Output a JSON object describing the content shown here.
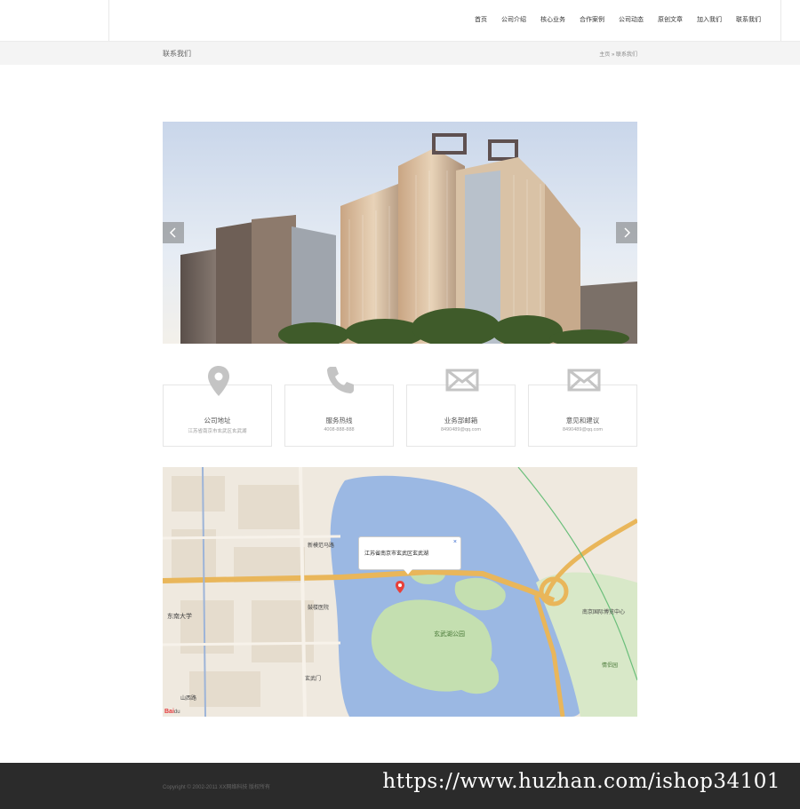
{
  "nav": {
    "items": [
      "首页",
      "公司介绍",
      "核心业务",
      "合作案例",
      "公司动态",
      "原创文章",
      "加入我们",
      "联系我们"
    ]
  },
  "subbar": {
    "title": "联系我们",
    "breadcrumb_home": "主页",
    "breadcrumb_sep": "»",
    "breadcrumb_current": "联系我们"
  },
  "slider": {
    "prev_icon": "chevron-left-icon",
    "next_icon": "chevron-right-icon"
  },
  "contacts": [
    {
      "icon": "location-pin-icon",
      "title": "公司地址",
      "sub": "江苏省南京市玄武区玄武湖"
    },
    {
      "icon": "phone-icon",
      "title": "服务热线",
      "sub": "4008-888-888"
    },
    {
      "icon": "envelope-icon",
      "title": "业务部邮箱",
      "sub": "8490489@qq.com"
    },
    {
      "icon": "envelope-icon",
      "title": "意见和建议",
      "sub": "8490489@qq.com"
    }
  ],
  "map": {
    "popup_text": "江苏省南京市玄武区玄武湖",
    "popup_close": "×",
    "lake_label": "玄武湖公园",
    "place_labels": [
      "东南大学",
      "新模范马路",
      "南京国际博览中心",
      "情侣园",
      "鼓楼医院",
      "玄武门",
      "山西路"
    ],
    "logo_brand": "Bai",
    "logo_suffix": "du"
  },
  "footer": {
    "copyright": "Copyright © 2002-2011 XX网络科技 版权所有",
    "watermark": "https://www.huzhan.com/ishop34101"
  },
  "colors": {
    "footer_bg": "#2b2b2b",
    "subbar_bg": "#f4f4f4",
    "lake": "#9bb8e3",
    "park": "#c4dfb0"
  }
}
